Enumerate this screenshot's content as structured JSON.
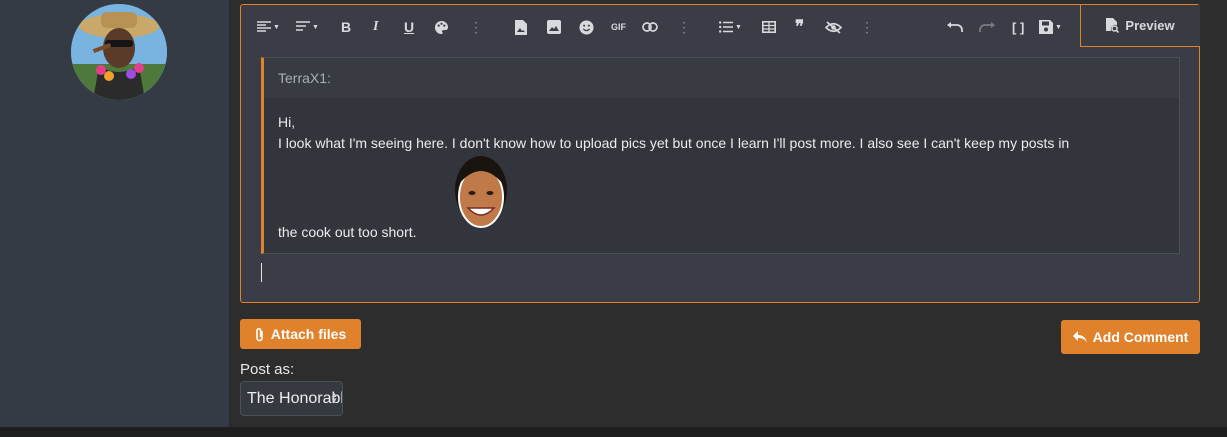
{
  "user": {
    "avatar_icon": "user-avatar-photo"
  },
  "editor": {
    "toolbar": [
      {
        "name": "align-button",
        "icon": "align-left-icon",
        "dropdown": true
      },
      {
        "name": "paragraph-format-button",
        "icon": "paragraph-icon",
        "dropdown": true
      },
      {
        "name": "bold-button",
        "label": "B"
      },
      {
        "name": "italic-button",
        "label": "I"
      },
      {
        "name": "underline-button",
        "label": "U"
      },
      {
        "name": "text-color-button",
        "icon": "palette-icon"
      },
      {
        "name": "more-text-button",
        "icon": "more-vertical-icon"
      },
      {
        "name": "insert-file-button",
        "icon": "file-image-icon"
      },
      {
        "name": "insert-image-button",
        "icon": "image-icon"
      },
      {
        "name": "insert-smilie-button",
        "icon": "smiley-icon"
      },
      {
        "name": "insert-gif-button",
        "label": "GIF"
      },
      {
        "name": "insert-link-button",
        "icon": "link-icon"
      },
      {
        "name": "more-insert-button",
        "icon": "more-vertical-icon"
      },
      {
        "name": "list-button",
        "icon": "list-icon",
        "dropdown": true
      },
      {
        "name": "table-button",
        "icon": "table-icon"
      },
      {
        "name": "quote-button",
        "icon": "quote-icon"
      },
      {
        "name": "spoiler-button",
        "icon": "eye-slash-icon"
      },
      {
        "name": "more-paragraph-button",
        "icon": "more-vertical-icon"
      },
      {
        "name": "undo-button",
        "icon": "undo-icon"
      },
      {
        "name": "redo-button",
        "icon": "redo-icon"
      },
      {
        "name": "bbcode-toggle-button",
        "label": "[ ]"
      },
      {
        "name": "drafts-button",
        "icon": "save-icon",
        "dropdown": true
      }
    ],
    "preview_label": "Preview",
    "quote": {
      "author": "TerraX1:",
      "line1": "Hi,",
      "line2": "I look what I'm seeing here. I don't know how to upload pics yet but once I learn I'll post more. I also see I can't keep my posts in",
      "line3": "the cook out too short.",
      "smilie_icon": "laughing-face-smilie"
    }
  },
  "actions": {
    "attach_label": "Attach files",
    "add_comment_label": "Add Comment"
  },
  "post_as": {
    "label": "Post as:",
    "selected": "The Honorable"
  },
  "colors": {
    "accent": "#e0812b",
    "background": "#2d2d2d",
    "sidebar": "#353b44"
  }
}
